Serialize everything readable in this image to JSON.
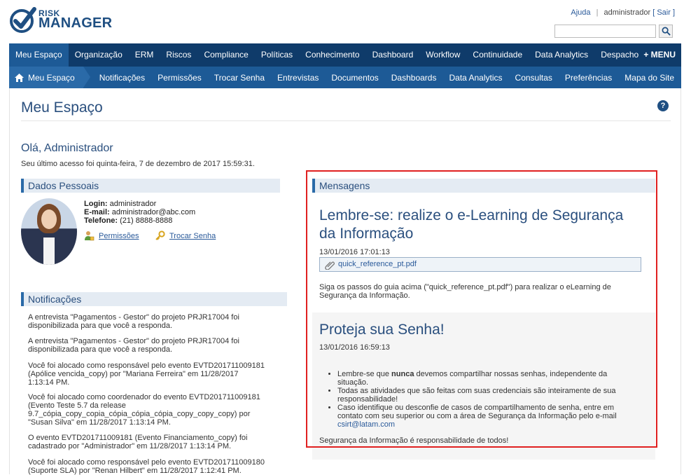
{
  "header": {
    "logo_top": "RISK",
    "logo_bottom": "MANAGER",
    "help_link": "Ajuda",
    "separator": "|",
    "username": "administrador",
    "logout_prefix": "[",
    "logout_label": "Sair",
    "logout_suffix": "]",
    "search_placeholder": ""
  },
  "main_nav": {
    "items": [
      "Meu Espaço",
      "Organização",
      "ERM",
      "Riscos",
      "Compliance",
      "Políticas",
      "Conhecimento",
      "Dashboard",
      "Workflow",
      "Continuidade",
      "Data Analytics",
      "Despacho"
    ],
    "more_label": "+ MENU"
  },
  "sub_nav": {
    "home_label": "Meu Espaço",
    "items": [
      "Notificações",
      "Permissões",
      "Trocar Senha",
      "Entrevistas",
      "Documentos",
      "Dashboards",
      "Data Analytics",
      "Consultas",
      "Preferências",
      "Mapa do Site"
    ]
  },
  "page": {
    "title": "Meu Espaço",
    "help_glyph": "?",
    "greeting": "Olá, Administrador",
    "last_access": "Seu último acesso foi quinta-feira, 7 de dezembro de 2017 15:59:31."
  },
  "personal": {
    "heading": "Dados Pessoais",
    "login_label": "Login:",
    "login_value": "administrador",
    "email_label": "E-mail:",
    "email_value": "administrador@abc.com",
    "phone_label": "Telefone:",
    "phone_value": "(21) 8888-8888",
    "permissions_link": "Permissões",
    "change_password_link": "Trocar Senha"
  },
  "notifications": {
    "heading": "Notificações",
    "items": [
      "A entrevista \"Pagamentos - Gestor\" do projeto PRJR17004 foi disponibilizada para que você a responda.",
      "A entrevista \"Pagamentos - Gestor\" do projeto PRJR17004 foi disponibilizada para que você a responda.",
      "Você foi alocado como responsável pelo evento EVTD201711009181 (Apólice vencida_copy) por \"Mariana Ferreira\" em 11/28/2017 1:13:14 PM.",
      "Você foi alocado como coordenador do evento EVTD201711009181 (Evento Teste 5.7 da release 9.7_cópia_copy_copia_cópia_cópia_cópia_copy_copy_copy) por \"Susan Silva\" em 11/28/2017 1:13:14 PM.",
      "O evento EVTD201711009181 (Evento Financiamento_copy) foi cadastrado por \"Administrador\" em 11/28/2017 1:13:14 PM.",
      "Você foi alocado como responsável pelo evento EVTD201711009180 (Suporte SLA) por \"Renan Hilbert\" em 11/28/2017 1:12:41 PM."
    ]
  },
  "messages": {
    "heading": "Mensagens",
    "msg1": {
      "title": "Lembre-se: realize o e-Learning de Segurança da Informação",
      "date": "13/01/2016 17:01:13",
      "attachment": "quick_reference_pt.pdf",
      "body": "Siga os passos do guia acima (\"quick_reference_pt.pdf\") para realizar o eLearning de Segurança da Informação."
    },
    "msg2": {
      "title": "Proteja sua Senha!",
      "date": "13/01/2016 16:59:13",
      "bullet1_pre": "Lembre-se que ",
      "bullet1_bold": "nunca",
      "bullet1_post": " devemos compartilhar nossas senhas, independente da situação.",
      "bullet2": "Todas as atividades que são feitas com suas credenciais são inteiramente de sua responsabilidade!",
      "bullet3": "Caso identifique ou desconfie de casos de compartilhamento de senha, entre em contato com seu superior ou com a área de Segurança da Informação pelo e-mail",
      "email": "csirt@latam.com",
      "footer": "Segurança da Informação é responsabilidade de todos!"
    }
  }
}
